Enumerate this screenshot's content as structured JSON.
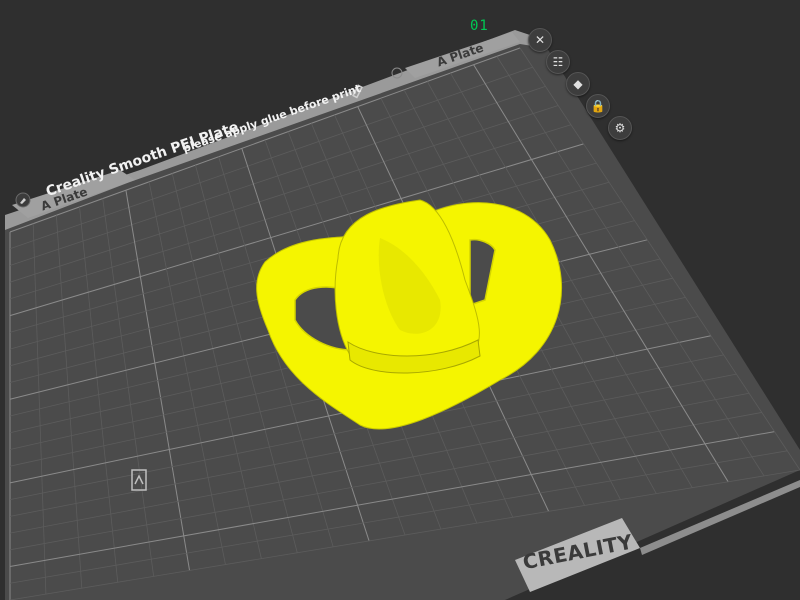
{
  "plate": {
    "number": "01",
    "tab_left_label": "A Plate",
    "tab_right_label": "A Plate",
    "note": "please apply glue before print",
    "bed_type": "Creality Smooth PEI Plate",
    "brand": "CREALITY"
  },
  "plate_tools": [
    {
      "name": "close-plate-button",
      "icon": "close-icon",
      "glyph": "✕"
    },
    {
      "name": "arrange-plate-button",
      "icon": "arrange-icon",
      "glyph": "☷"
    },
    {
      "name": "orient-plate-button",
      "icon": "orient-icon",
      "glyph": "◆"
    },
    {
      "name": "lock-plate-button",
      "icon": "lock-icon",
      "glyph": "🔒"
    },
    {
      "name": "plate-settings-button",
      "icon": "gear-icon",
      "glyph": "⚙"
    }
  ],
  "colors": {
    "background": "#2f2f2f",
    "bed": "#4a4a4a",
    "grid_major": "#8a8a8a",
    "grid_minor": "#5c5c5c",
    "model": "#f5f500",
    "plate_number": "#00c853"
  }
}
